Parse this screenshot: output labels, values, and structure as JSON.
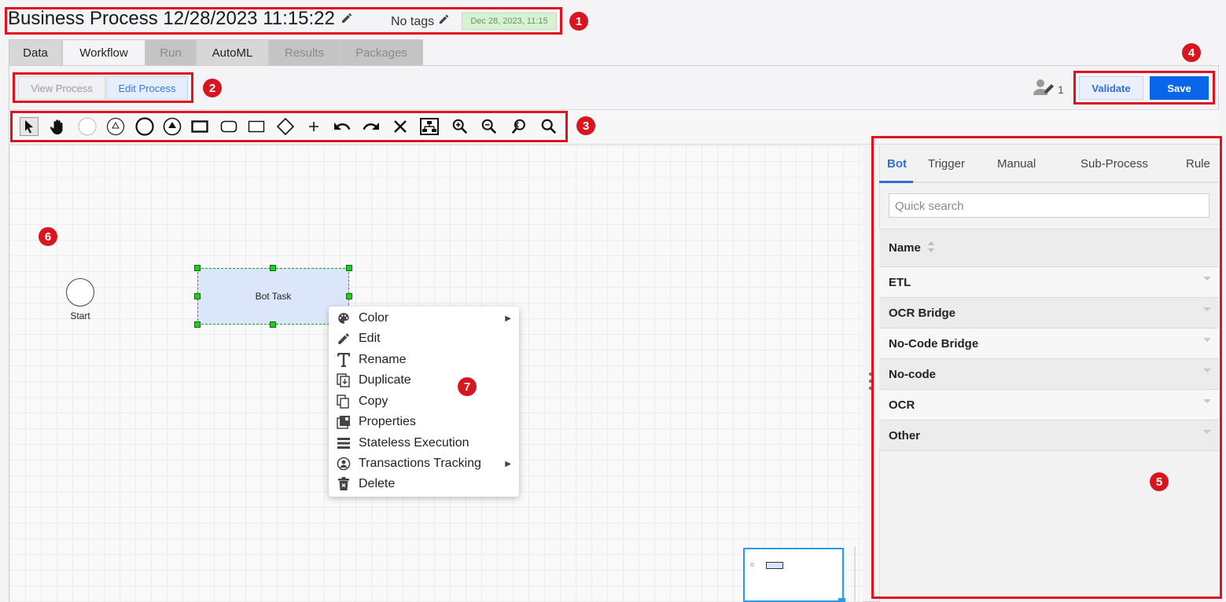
{
  "header": {
    "title": "Business Process 12/28/2023 11:15:22",
    "tags_label": "No tags",
    "date_chip": "Dec 28, 2023, 11:15"
  },
  "tabs": [
    {
      "label": "Data",
      "state": "enabled"
    },
    {
      "label": "Workflow",
      "state": "active"
    },
    {
      "label": "Run",
      "state": "disabled"
    },
    {
      "label": "AutoML",
      "state": "enabled"
    },
    {
      "label": "Results",
      "state": "disabled"
    },
    {
      "label": "Packages",
      "state": "disabled"
    }
  ],
  "mode_buttons": {
    "view": "View Process",
    "edit": "Edit Process"
  },
  "collaborators": {
    "count": "1"
  },
  "actions": {
    "validate": "Validate",
    "save": "Save"
  },
  "toolbar_icons": [
    "pointer-icon",
    "hand-pan-icon",
    "start-event-icon",
    "intermediate-event-icon",
    "end-event-icon",
    "end-signal-event-icon",
    "task-icon",
    "subprocess-icon",
    "rectangle-icon",
    "gateway-icon",
    "add-icon",
    "undo-icon",
    "redo-icon",
    "delete-icon",
    "auto-layout-icon",
    "zoom-in-icon",
    "zoom-out-icon",
    "zoom-fit-icon",
    "zoom-reset-icon"
  ],
  "canvas": {
    "start_label": "Start",
    "task_label": "Bot Task"
  },
  "context_menu": [
    {
      "label": "Color",
      "icon": "palette-icon",
      "submenu": true
    },
    {
      "label": "Edit",
      "icon": "pencil-icon",
      "submenu": false
    },
    {
      "label": "Rename",
      "icon": "text-icon",
      "submenu": false
    },
    {
      "label": "Duplicate",
      "icon": "duplicate-icon",
      "submenu": false
    },
    {
      "label": "Copy",
      "icon": "copy-icon",
      "submenu": false
    },
    {
      "label": "Properties",
      "icon": "properties-icon",
      "submenu": false
    },
    {
      "label": "Stateless Execution",
      "icon": "list-icon",
      "submenu": false
    },
    {
      "label": "Transactions Tracking",
      "icon": "tracking-icon",
      "submenu": true
    },
    {
      "label": "Delete",
      "icon": "trash-icon",
      "submenu": false
    }
  ],
  "palette": {
    "tabs": [
      "Bot",
      "Trigger",
      "Manual",
      "Sub-Process",
      "Rule"
    ],
    "active_tab": "Bot",
    "search_placeholder": "Quick search",
    "column_header": "Name",
    "groups": [
      "ETL",
      "OCR Bridge",
      "No-Code Bridge",
      "No-code",
      "OCR",
      "Other"
    ]
  },
  "callouts": [
    "1",
    "2",
    "3",
    "4",
    "5",
    "6",
    "7"
  ],
  "colors": {
    "accent": "#0a66e8",
    "callout": "#d81620",
    "selection": "#1fcf1f",
    "task_fill": "#dbe6fb"
  }
}
